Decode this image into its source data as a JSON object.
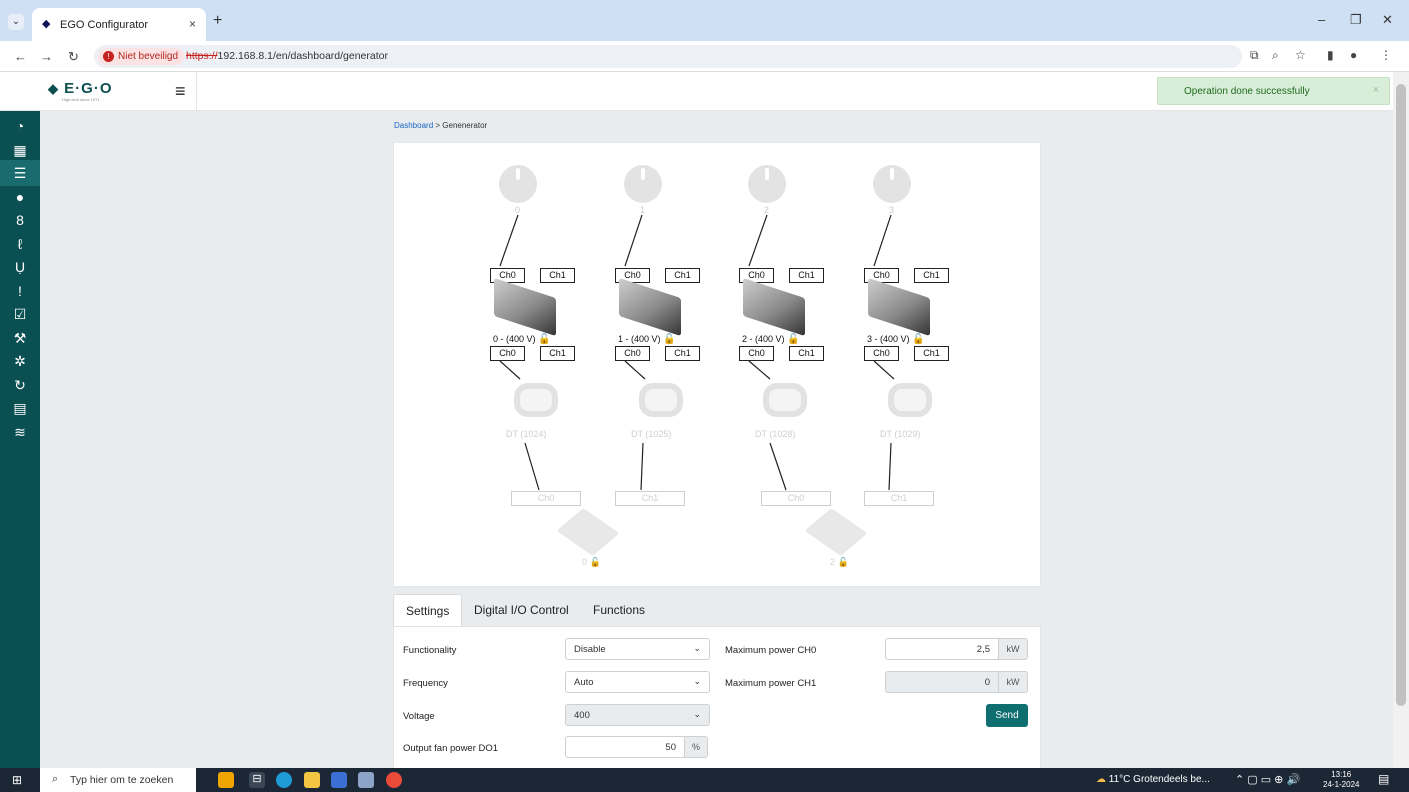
{
  "browser": {
    "tab_title": "EGO Configurator",
    "tab_close": "×",
    "new_tab": "+",
    "security_label": "Niet beveiligd",
    "url_scheme": "https://",
    "url_rest": "192.168.8.1/en/dashboard/generator",
    "minimize": "–",
    "restore": "❐",
    "close": "✕"
  },
  "app": {
    "logo_text": "E·G·O",
    "logo_tagline": "High-tech since 1971",
    "menu_icon": "≡"
  },
  "toast": {
    "message": "Operation done successfully",
    "close": "×"
  },
  "sidebar": {
    "items": [
      {
        "icon": "dashboard-icon",
        "glyph": "◔"
      },
      {
        "icon": "table-icon",
        "glyph": "▦"
      },
      {
        "icon": "sliders-icon",
        "glyph": "☰"
      },
      {
        "icon": "circle-icon",
        "glyph": "●"
      },
      {
        "icon": "sensor-icon",
        "glyph": "8"
      },
      {
        "icon": "thermometer-icon",
        "glyph": "ℓ"
      },
      {
        "icon": "stethoscope-icon",
        "glyph": "Ụ"
      },
      {
        "icon": "alert-icon",
        "glyph": "!"
      },
      {
        "icon": "checkbox-icon",
        "glyph": "☑"
      },
      {
        "icon": "wrench-icon",
        "glyph": "⚒"
      },
      {
        "icon": "spinner-icon",
        "glyph": "✲"
      },
      {
        "icon": "refresh-icon",
        "glyph": "↻"
      },
      {
        "icon": "database-icon",
        "glyph": "▤"
      },
      {
        "icon": "wifi-icon",
        "glyph": "≋"
      }
    ]
  },
  "breadcrumb": {
    "root": "Dashboard",
    "separator": ">",
    "current": "Genenerator"
  },
  "diagram": {
    "knobs": [
      "0",
      "1",
      "2",
      "3"
    ],
    "generators": [
      {
        "label": "0 - (400 V)",
        "ch0": "Ch0",
        "ch1": "Ch1"
      },
      {
        "label": "1 - (400 V)",
        "ch0": "Ch0",
        "ch1": "Ch1"
      },
      {
        "label": "2 - (400 V)",
        "ch0": "Ch0",
        "ch1": "Ch1"
      },
      {
        "label": "3 - (400 V)",
        "ch0": "Ch0",
        "ch1": "Ch1"
      }
    ],
    "transformers": [
      "DT (1024)",
      "DT (1025)",
      "DT (1028)",
      "DT (1029)"
    ],
    "controller_channels": [
      "Ch0",
      "Ch1",
      "Ch0",
      "Ch1"
    ],
    "controllers": [
      "0",
      "2"
    ]
  },
  "tabs": [
    "Settings",
    "Digital I/O Control",
    "Functions"
  ],
  "form": {
    "functionality": {
      "label": "Functionality",
      "value": "Disable"
    },
    "frequency": {
      "label": "Frequency",
      "value": "Auto"
    },
    "voltage": {
      "label": "Voltage",
      "value": "400"
    },
    "fan_power": {
      "label": "Output fan power DO1",
      "value": "50",
      "unit": "%"
    },
    "max_power_ch0": {
      "label": "Maximum power CH0",
      "value": "2,5",
      "unit": "kW"
    },
    "max_power_ch1": {
      "label": "Maximum power CH1",
      "value": "0",
      "unit": "kW"
    },
    "send": "Send"
  },
  "taskbar": {
    "search_placeholder": "Typ hier om te zoeken",
    "weather": "11°C  Grotendeels be...",
    "time": "13:16",
    "date": "24-1-2024"
  }
}
